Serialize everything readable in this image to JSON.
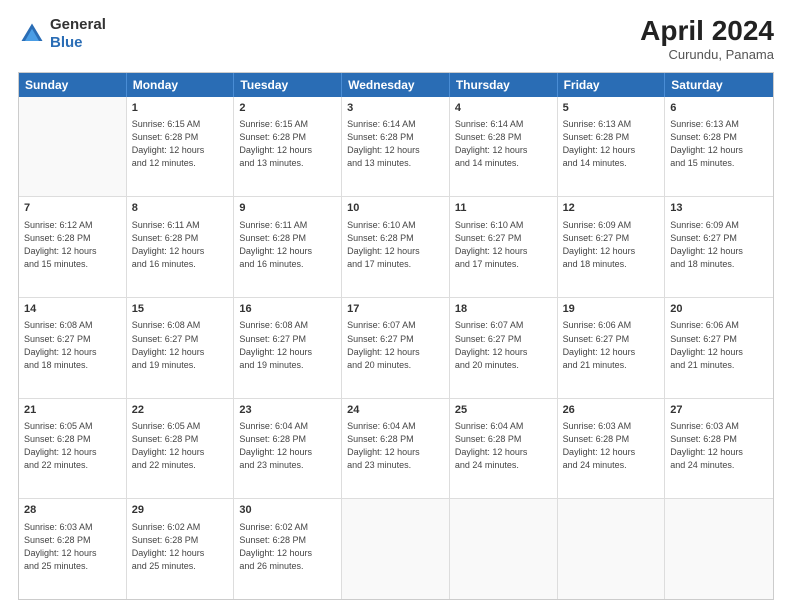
{
  "header": {
    "logo_line1": "General",
    "logo_line2": "Blue",
    "main_title": "April 2024",
    "subtitle": "Curundu, Panama"
  },
  "days": [
    "Sunday",
    "Monday",
    "Tuesday",
    "Wednesday",
    "Thursday",
    "Friday",
    "Saturday"
  ],
  "rows": [
    [
      {
        "num": "",
        "lines": []
      },
      {
        "num": "1",
        "lines": [
          "Sunrise: 6:15 AM",
          "Sunset: 6:28 PM",
          "Daylight: 12 hours",
          "and 12 minutes."
        ]
      },
      {
        "num": "2",
        "lines": [
          "Sunrise: 6:15 AM",
          "Sunset: 6:28 PM",
          "Daylight: 12 hours",
          "and 13 minutes."
        ]
      },
      {
        "num": "3",
        "lines": [
          "Sunrise: 6:14 AM",
          "Sunset: 6:28 PM",
          "Daylight: 12 hours",
          "and 13 minutes."
        ]
      },
      {
        "num": "4",
        "lines": [
          "Sunrise: 6:14 AM",
          "Sunset: 6:28 PM",
          "Daylight: 12 hours",
          "and 14 minutes."
        ]
      },
      {
        "num": "5",
        "lines": [
          "Sunrise: 6:13 AM",
          "Sunset: 6:28 PM",
          "Daylight: 12 hours",
          "and 14 minutes."
        ]
      },
      {
        "num": "6",
        "lines": [
          "Sunrise: 6:13 AM",
          "Sunset: 6:28 PM",
          "Daylight: 12 hours",
          "and 15 minutes."
        ]
      }
    ],
    [
      {
        "num": "7",
        "lines": [
          "Sunrise: 6:12 AM",
          "Sunset: 6:28 PM",
          "Daylight: 12 hours",
          "and 15 minutes."
        ]
      },
      {
        "num": "8",
        "lines": [
          "Sunrise: 6:11 AM",
          "Sunset: 6:28 PM",
          "Daylight: 12 hours",
          "and 16 minutes."
        ]
      },
      {
        "num": "9",
        "lines": [
          "Sunrise: 6:11 AM",
          "Sunset: 6:28 PM",
          "Daylight: 12 hours",
          "and 16 minutes."
        ]
      },
      {
        "num": "10",
        "lines": [
          "Sunrise: 6:10 AM",
          "Sunset: 6:28 PM",
          "Daylight: 12 hours",
          "and 17 minutes."
        ]
      },
      {
        "num": "11",
        "lines": [
          "Sunrise: 6:10 AM",
          "Sunset: 6:27 PM",
          "Daylight: 12 hours",
          "and 17 minutes."
        ]
      },
      {
        "num": "12",
        "lines": [
          "Sunrise: 6:09 AM",
          "Sunset: 6:27 PM",
          "Daylight: 12 hours",
          "and 18 minutes."
        ]
      },
      {
        "num": "13",
        "lines": [
          "Sunrise: 6:09 AM",
          "Sunset: 6:27 PM",
          "Daylight: 12 hours",
          "and 18 minutes."
        ]
      }
    ],
    [
      {
        "num": "14",
        "lines": [
          "Sunrise: 6:08 AM",
          "Sunset: 6:27 PM",
          "Daylight: 12 hours",
          "and 18 minutes."
        ]
      },
      {
        "num": "15",
        "lines": [
          "Sunrise: 6:08 AM",
          "Sunset: 6:27 PM",
          "Daylight: 12 hours",
          "and 19 minutes."
        ]
      },
      {
        "num": "16",
        "lines": [
          "Sunrise: 6:08 AM",
          "Sunset: 6:27 PM",
          "Daylight: 12 hours",
          "and 19 minutes."
        ]
      },
      {
        "num": "17",
        "lines": [
          "Sunrise: 6:07 AM",
          "Sunset: 6:27 PM",
          "Daylight: 12 hours",
          "and 20 minutes."
        ]
      },
      {
        "num": "18",
        "lines": [
          "Sunrise: 6:07 AM",
          "Sunset: 6:27 PM",
          "Daylight: 12 hours",
          "and 20 minutes."
        ]
      },
      {
        "num": "19",
        "lines": [
          "Sunrise: 6:06 AM",
          "Sunset: 6:27 PM",
          "Daylight: 12 hours",
          "and 21 minutes."
        ]
      },
      {
        "num": "20",
        "lines": [
          "Sunrise: 6:06 AM",
          "Sunset: 6:27 PM",
          "Daylight: 12 hours",
          "and 21 minutes."
        ]
      }
    ],
    [
      {
        "num": "21",
        "lines": [
          "Sunrise: 6:05 AM",
          "Sunset: 6:28 PM",
          "Daylight: 12 hours",
          "and 22 minutes."
        ]
      },
      {
        "num": "22",
        "lines": [
          "Sunrise: 6:05 AM",
          "Sunset: 6:28 PM",
          "Daylight: 12 hours",
          "and 22 minutes."
        ]
      },
      {
        "num": "23",
        "lines": [
          "Sunrise: 6:04 AM",
          "Sunset: 6:28 PM",
          "Daylight: 12 hours",
          "and 23 minutes."
        ]
      },
      {
        "num": "24",
        "lines": [
          "Sunrise: 6:04 AM",
          "Sunset: 6:28 PM",
          "Daylight: 12 hours",
          "and 23 minutes."
        ]
      },
      {
        "num": "25",
        "lines": [
          "Sunrise: 6:04 AM",
          "Sunset: 6:28 PM",
          "Daylight: 12 hours",
          "and 24 minutes."
        ]
      },
      {
        "num": "26",
        "lines": [
          "Sunrise: 6:03 AM",
          "Sunset: 6:28 PM",
          "Daylight: 12 hours",
          "and 24 minutes."
        ]
      },
      {
        "num": "27",
        "lines": [
          "Sunrise: 6:03 AM",
          "Sunset: 6:28 PM",
          "Daylight: 12 hours",
          "and 24 minutes."
        ]
      }
    ],
    [
      {
        "num": "28",
        "lines": [
          "Sunrise: 6:03 AM",
          "Sunset: 6:28 PM",
          "Daylight: 12 hours",
          "and 25 minutes."
        ]
      },
      {
        "num": "29",
        "lines": [
          "Sunrise: 6:02 AM",
          "Sunset: 6:28 PM",
          "Daylight: 12 hours",
          "and 25 minutes."
        ]
      },
      {
        "num": "30",
        "lines": [
          "Sunrise: 6:02 AM",
          "Sunset: 6:28 PM",
          "Daylight: 12 hours",
          "and 26 minutes."
        ]
      },
      {
        "num": "",
        "lines": []
      },
      {
        "num": "",
        "lines": []
      },
      {
        "num": "",
        "lines": []
      },
      {
        "num": "",
        "lines": []
      }
    ]
  ]
}
